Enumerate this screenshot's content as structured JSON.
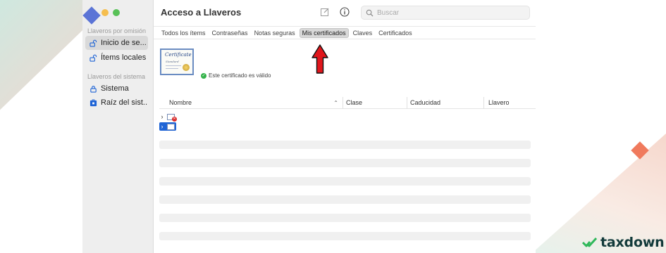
{
  "window": {
    "title": "Acceso a Llaveros"
  },
  "sidebar": {
    "section_default": "Llaveros por omisión",
    "default_items": [
      {
        "label": "Inicio de se...",
        "icon": "unlocked-lock-icon"
      },
      {
        "label": "Ítems locales",
        "icon": "unlocked-lock-icon"
      }
    ],
    "section_system": "Llaveros del sistema",
    "system_items": [
      {
        "label": "Sistema",
        "icon": "lock-icon"
      },
      {
        "label": "Raíz del sist...",
        "icon": "cabinet-lock-icon"
      }
    ]
  },
  "toolbar": {
    "compose_icon": "compose-icon",
    "info_icon": "info-icon",
    "search_placeholder": "Buscar"
  },
  "tabs": [
    {
      "label": "Todos los ítems",
      "active": false
    },
    {
      "label": "Contraseñas",
      "active": false
    },
    {
      "label": "Notas seguras",
      "active": false
    },
    {
      "label": "Mis certificados",
      "active": true
    },
    {
      "label": "Claves",
      "active": false
    },
    {
      "label": "Certificados",
      "active": false
    }
  ],
  "certificate_preview": {
    "thumb_title": "Certificate",
    "thumb_subtitle": "Standard",
    "status": "Este certificado es válido"
  },
  "table": {
    "columns": [
      "Nombre",
      "Clase",
      "Caducidad",
      "Llavero"
    ],
    "sort_column": "Nombre",
    "sort_direction": "ascending"
  },
  "brand": {
    "name": "taxdown",
    "accent": "#2fb85a"
  },
  "colors": {
    "selection_blue": "#1f64d6",
    "annotation_red": "#e0161c",
    "valid_green": "#34b24a"
  }
}
